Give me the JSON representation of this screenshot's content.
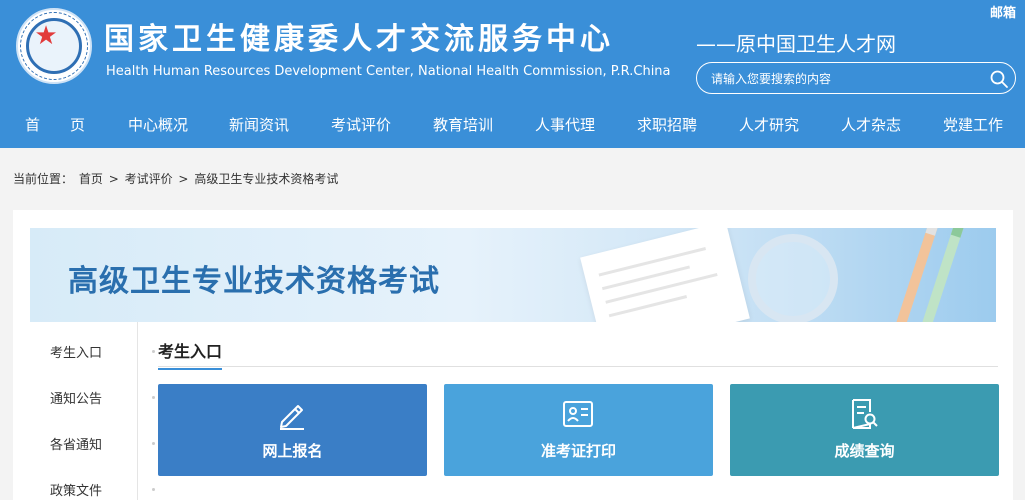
{
  "header": {
    "title": "国家卫生健康委人才交流服务中心",
    "subtitle": "Health Human Resources Development Center, National Health Commission, P.R.China",
    "former_name": "——原中国卫生人才网",
    "mail_label": "邮箱",
    "logo_icon": "emblem-logo-icon",
    "background_color": "#3a8fd8"
  },
  "search": {
    "placeholder": "请输入您要搜索的内容",
    "icon": "search-icon"
  },
  "nav": {
    "items": [
      {
        "label": "首　　页"
      },
      {
        "label": "中心概况"
      },
      {
        "label": "新闻资讯"
      },
      {
        "label": "考试评价"
      },
      {
        "label": "教育培训"
      },
      {
        "label": "人事代理"
      },
      {
        "label": "求职招聘"
      },
      {
        "label": "人才研究"
      },
      {
        "label": "人才杂志"
      },
      {
        "label": "党建工作"
      }
    ]
  },
  "breadcrumb": {
    "prefix": "当前位置：",
    "items": [
      {
        "label": "首页"
      },
      {
        "label": "考试评价"
      },
      {
        "label": "高级卫生专业技术资格考试"
      }
    ],
    "separator": ">"
  },
  "banner": {
    "title": "高级卫生专业技术资格考试"
  },
  "sidebar": {
    "items": [
      {
        "label": "考生入口"
      },
      {
        "label": "通知公告"
      },
      {
        "label": "各省通知"
      },
      {
        "label": "政策文件"
      }
    ]
  },
  "section": {
    "title": "考生入口"
  },
  "tiles": [
    {
      "label": "网上报名",
      "icon": "pencil-icon",
      "color": "#3a7ec6"
    },
    {
      "label": "准考证打印",
      "icon": "id-card-icon",
      "color": "#4aa3dc"
    },
    {
      "label": "成绩查询",
      "icon": "document-search-icon",
      "color": "#3b9bb1"
    }
  ]
}
